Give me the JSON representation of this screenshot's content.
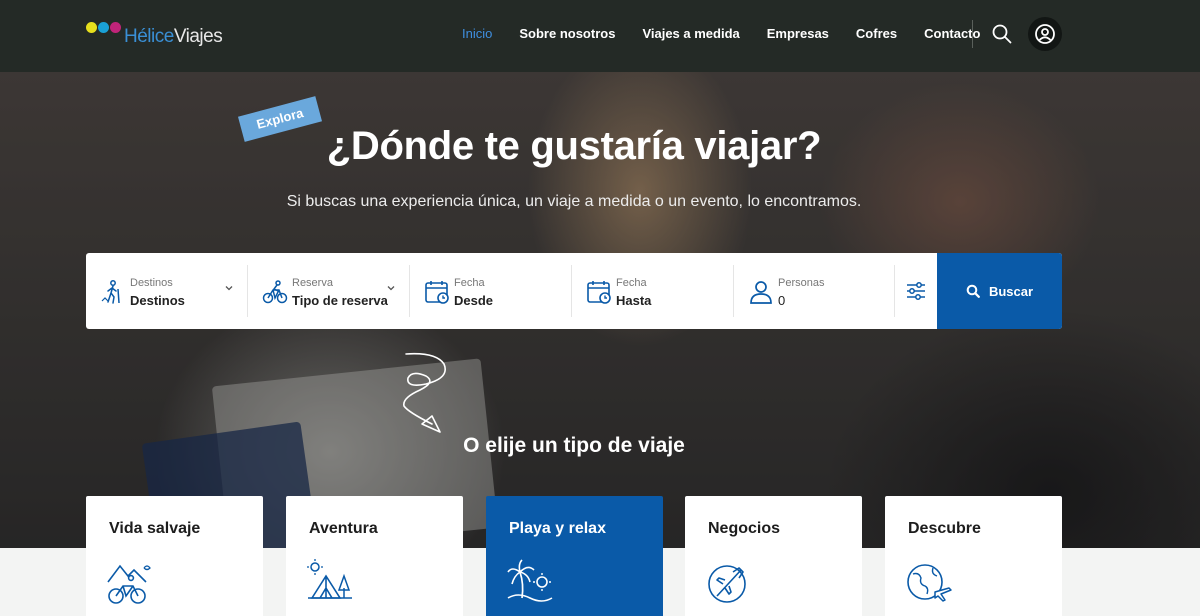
{
  "brand": {
    "name_part1": "Hélice",
    "name_part2": "Viajes"
  },
  "nav": {
    "items": [
      "Inicio",
      "Sobre nosotros",
      "Viajes a medida",
      "Empresas",
      "Cofres",
      "Contacto"
    ],
    "active": "Inicio"
  },
  "hero": {
    "tag": "Explora",
    "title": "¿Dónde te gustaría viajar?",
    "subtitle": "Si buscas una experiencia única, un viaje a medida o un evento, lo encontramos."
  },
  "search": {
    "fields": [
      {
        "label": "Destinos",
        "value": "Destinos",
        "icon": "hiker-icon"
      },
      {
        "label": "Reserva",
        "value": "Tipo de reserva",
        "icon": "cyclist-icon"
      },
      {
        "label": "Fecha",
        "value": "Desde",
        "icon": "calendar-icon"
      },
      {
        "label": "Fecha",
        "value": "Hasta",
        "icon": "calendar-icon"
      },
      {
        "label": "Personas",
        "value": "0",
        "icon": "person-icon"
      }
    ],
    "button": "Buscar"
  },
  "categories_heading": "O elije un tipo de viaje",
  "categories": [
    {
      "label": "Vida salvaje",
      "icon": "mountain-bike-icon"
    },
    {
      "label": "Aventura",
      "icon": "camping-tent-icon"
    },
    {
      "label": "Playa y relax",
      "icon": "palm-beach-icon"
    },
    {
      "label": "Negocios",
      "icon": "airplane-globe-icon"
    },
    {
      "label": "Descubre",
      "icon": "globe-plane-icon"
    }
  ],
  "colors": {
    "primary": "#0a5aa8",
    "header_bg": "#242a26",
    "accent_tag": "#6aa8dc",
    "nav_active": "#3f8fe0"
  }
}
